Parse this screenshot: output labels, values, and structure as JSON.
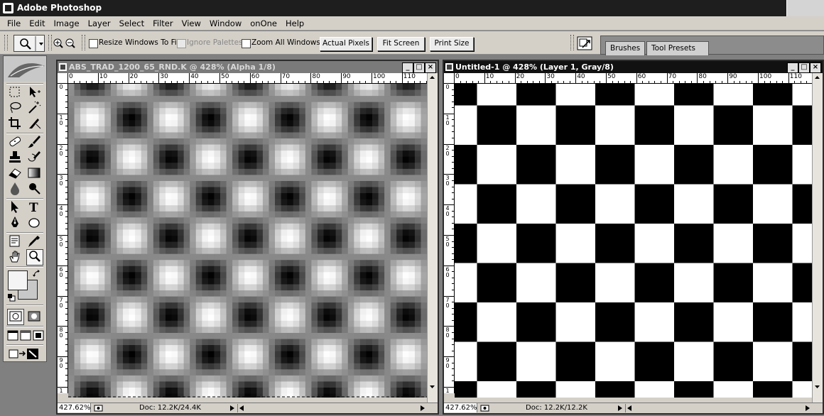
{
  "app": {
    "title": "Adobe Photoshop"
  },
  "menu": [
    "File",
    "Edit",
    "Image",
    "Layer",
    "Select",
    "Filter",
    "View",
    "Window",
    "onOne",
    "Help"
  ],
  "options": {
    "resize_windows": "Resize Windows To Fit",
    "ignore_palettes": "Ignore Palettes",
    "zoom_all": "Zoom All Windows",
    "actual_pixels": "Actual Pixels",
    "fit_screen": "Fit Screen",
    "print_size": "Print Size"
  },
  "palette_well": {
    "tabs": [
      "Brushes",
      "Tool Presets"
    ]
  },
  "tools": {
    "icons": [
      "feather-icon",
      "marquee-icon",
      "move-icon",
      "lasso-icon",
      "magic-wand-icon",
      "crop-icon",
      "slice-icon",
      "healing-brush-icon",
      "brush-icon",
      "clone-stamp-icon",
      "history-brush-icon",
      "eraser-icon",
      "gradient-icon",
      "blur-icon",
      "dodge-icon",
      "path-selection-icon",
      "type-icon",
      "pen-icon",
      "shape-icon",
      "notes-icon",
      "eyedropper-icon",
      "hand-icon",
      "zoom-icon"
    ],
    "foreground_color": "#f4f4f4",
    "background_color": "#c8c8c8"
  },
  "ruler": {
    "h_labels": [
      "0",
      "10",
      "20",
      "30",
      "40",
      "50",
      "60",
      "70",
      "80",
      "90",
      "100",
      "110"
    ],
    "v_labels": [
      "0",
      "1 0",
      "2 0",
      "3 0",
      "4 0",
      "5 0",
      "6 0",
      "7 0",
      "8 0",
      "9 0",
      "1 0"
    ]
  },
  "doc1": {
    "title": "ABS_TRAD_1200_65_RND.K @ 428% (Alpha 1/8)",
    "zoom": "427.62%",
    "doc_info": "Doc: 12.2K/24.4K"
  },
  "doc2": {
    "title": "Untitled-1 @ 428% (Layer 1, Gray/8)",
    "zoom": "427.62%",
    "doc_info": "Doc: 12.2K/12.2K"
  },
  "window_buttons": {
    "minimize": "_",
    "maximize": "□",
    "close": "×"
  }
}
